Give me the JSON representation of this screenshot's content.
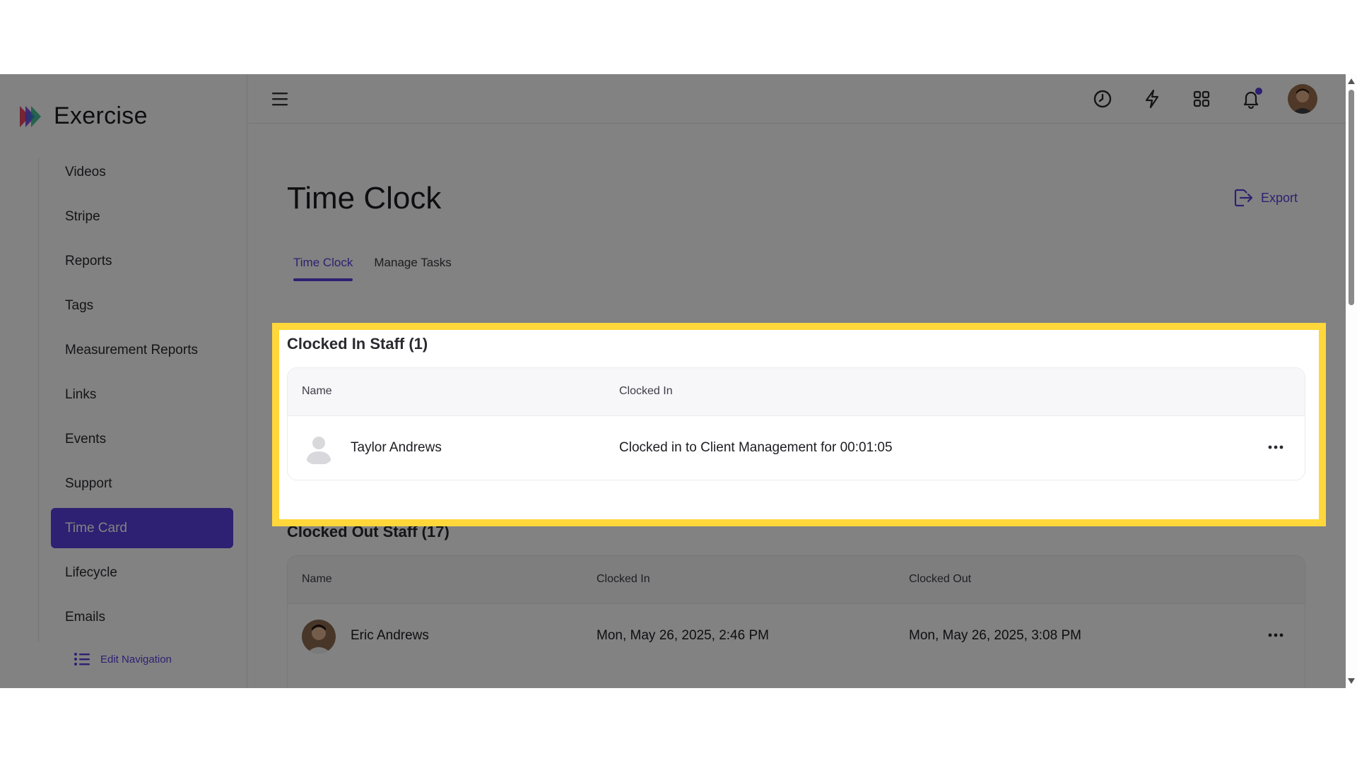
{
  "app": {
    "brand": "Exercise"
  },
  "sidebar": {
    "items": [
      {
        "label": "Videos"
      },
      {
        "label": "Stripe"
      },
      {
        "label": "Reports"
      },
      {
        "label": "Tags"
      },
      {
        "label": "Measurement Reports"
      },
      {
        "label": "Links"
      },
      {
        "label": "Events"
      },
      {
        "label": "Support"
      },
      {
        "label": "Time Card",
        "active": true
      },
      {
        "label": "Lifecycle"
      },
      {
        "label": "Emails"
      }
    ],
    "edit_nav": "Edit Navigation"
  },
  "topbar": {
    "icons": [
      "clock-icon",
      "lightning-icon",
      "grid-icon",
      "bell-icon"
    ],
    "notification_dot_color": "#5a3fe0"
  },
  "page": {
    "title": "Time Clock",
    "export_label": "Export",
    "tabs": [
      {
        "label": "Time Clock",
        "active": true
      },
      {
        "label": "Manage Tasks"
      }
    ]
  },
  "clocked_in": {
    "title": "Clocked In Staff (1)",
    "columns": [
      "Name",
      "Clocked In"
    ],
    "rows": [
      {
        "name": "Taylor Andrews",
        "clocked_in": "Clocked in to Client Management for 00:01:05"
      }
    ]
  },
  "clocked_out": {
    "title": "Clocked Out Staff (17)",
    "columns": [
      "Name",
      "Clocked In",
      "Clocked Out"
    ],
    "rows": [
      {
        "name": "Eric Andrews",
        "clocked_in": "Mon, May 26, 2025, 2:46 PM",
        "clocked_out": "Mon, May 26, 2025, 3:08 PM"
      }
    ]
  },
  "colors": {
    "accent": "#5a3fe0",
    "highlight": "#ffd73a"
  }
}
